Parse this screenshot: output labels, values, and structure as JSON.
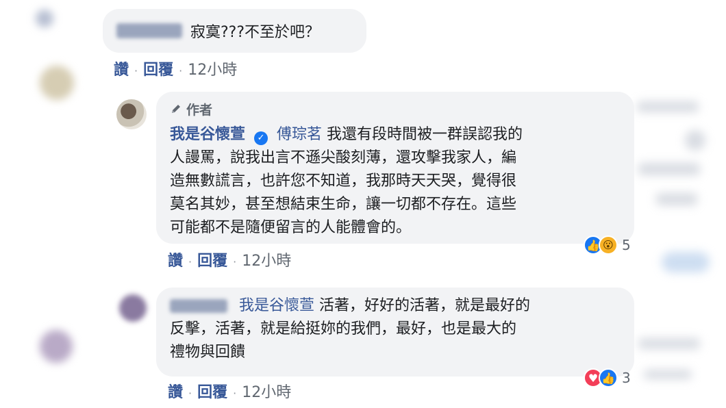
{
  "comment1": {
    "text": "寂寞???不至於吧？",
    "actions": {
      "like": "讚",
      "reply": "回覆",
      "time": "12小時"
    }
  },
  "comment2": {
    "badge_icon": "pencil-icon",
    "badge_label": "作者",
    "author": "我是谷懷萱",
    "verified_icon": "verified-check-icon",
    "mention": "傅琮茗",
    "text_lines": [
      "我還有段時間被一群誤認我的",
      "人謾罵，說我出言不遜尖酸刻薄，還攻擊我家人，編",
      "造無數謊言，也許您不知道，我那時天天哭，覺得很",
      "莫名其妙，甚至想結束生命，讓一切都不存在。這些",
      "可能都不是隨便留言的人能體會的。"
    ],
    "reaction_icons": [
      "like-icon",
      "wow-icon"
    ],
    "reaction_count": "5",
    "actions": {
      "like": "讚",
      "reply": "回覆",
      "time": "12小時"
    }
  },
  "comment3": {
    "mention": "我是谷懷萱",
    "text_lines": [
      "活著，好好的活著，就是最好的",
      "反擊，活著，就是給挺妳的我們，最好，也是最大的",
      "禮物與回饋"
    ],
    "reaction_icons": [
      "love-icon",
      "like-icon"
    ],
    "reaction_count": "3",
    "actions": {
      "like": "讚",
      "reply": "回覆",
      "time": "12小時"
    }
  },
  "colors": {
    "bubble": "#f2f3f5",
    "link": "#385898",
    "text": "#1c1e21"
  }
}
